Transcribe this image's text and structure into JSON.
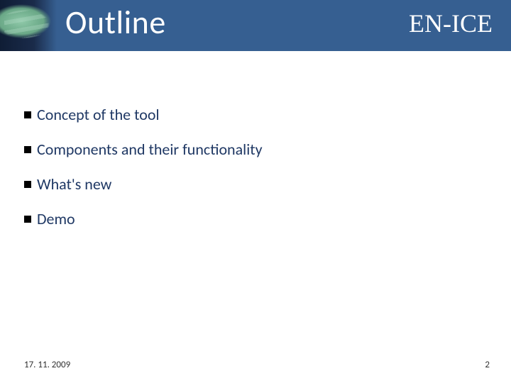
{
  "header": {
    "title": "Outline",
    "brand": "EN-ICE"
  },
  "bullets": {
    "items": [
      {
        "text": "Concept of the tool"
      },
      {
        "text": "Components and their functionality"
      },
      {
        "text": "What's new"
      },
      {
        "text": "Demo"
      }
    ]
  },
  "footer": {
    "date": "17. 11. 2009",
    "page": "2"
  }
}
